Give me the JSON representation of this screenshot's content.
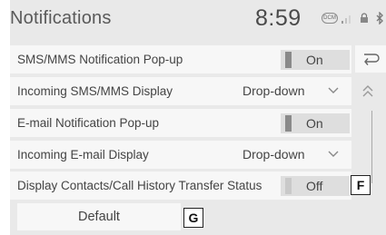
{
  "header": {
    "title": "Notifications",
    "time": "8:59",
    "status_badge": "DCM"
  },
  "rows": [
    {
      "label": "SMS/MMS Notification Pop-up",
      "kind": "toggle",
      "value": "On",
      "state": true
    },
    {
      "label": "Incoming SMS/MMS Display",
      "kind": "dropdown",
      "value": "Drop-down"
    },
    {
      "label": "E-mail Notification Pop-up",
      "kind": "toggle",
      "value": "On",
      "state": true
    },
    {
      "label": "Incoming E-mail Display",
      "kind": "dropdown",
      "value": "Drop-down"
    },
    {
      "label": "Display Contacts/Call History Transfer Status",
      "kind": "toggle",
      "value": "Off",
      "state": false
    }
  ],
  "default_button": {
    "label": "Default"
  },
  "callouts": {
    "f": "F",
    "g": "G"
  },
  "icons": {
    "back": "back-arrow-icon",
    "scroll_up": "chevron-double-up-icon",
    "dropdown": "chevron-down-icon",
    "signal": "signal-icon",
    "lock": "lock-icon",
    "bluetooth": "bluetooth-icon"
  }
}
